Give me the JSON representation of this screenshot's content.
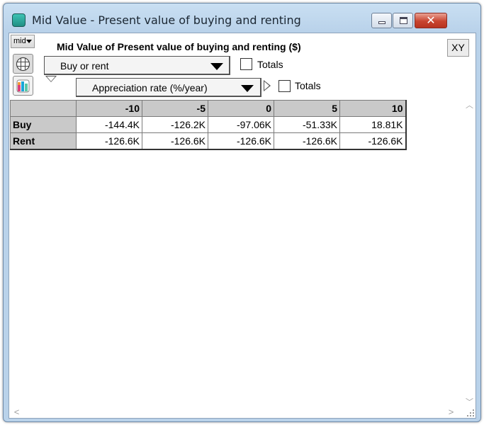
{
  "window": {
    "title": "Mid Value - Present value of buying and renting",
    "close_glyph": "✕"
  },
  "toolbar": {
    "mid_menu": "mid",
    "xy_button": "XY"
  },
  "result": {
    "title": "Mid Value of Present value of buying and renting ($)"
  },
  "row_index": {
    "selected": "Buy or rent",
    "totals_label": "Totals"
  },
  "col_index": {
    "selected": "Appreciation rate (%/year)",
    "totals_label": "Totals"
  },
  "table": {
    "columns": [
      "-10",
      "-5",
      "0",
      "5",
      "10"
    ],
    "rows": [
      {
        "label": "Buy",
        "values": [
          "-144.4K",
          "-126.2K",
          "-97.06K",
          "-51.33K",
          "18.81K"
        ]
      },
      {
        "label": "Rent",
        "values": [
          "-126.6K",
          "-126.6K",
          "-126.6K",
          "-126.6K",
          "-126.6K"
        ]
      }
    ]
  },
  "icons": {
    "app": "app-icon",
    "table_view": "table-view-icon",
    "graph_view": "graph-view-icon"
  },
  "scroll": {
    "up": "︿",
    "down": "﹀",
    "left": "<",
    "right": ">"
  }
}
